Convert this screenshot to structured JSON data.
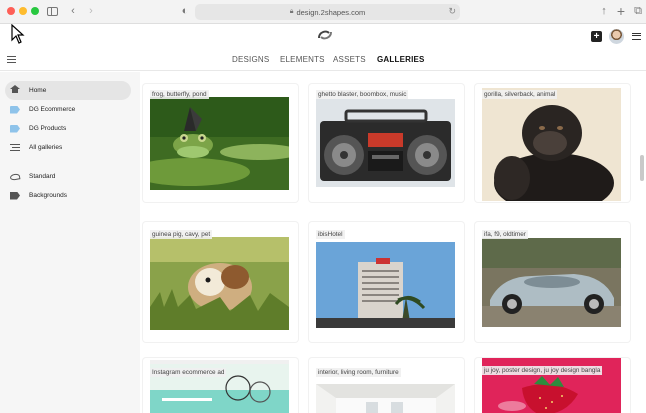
{
  "browser": {
    "url": "design.2shapes.com",
    "icons": [
      "sidebar-toggle-icon",
      "back-icon",
      "forward-icon",
      "privacy-shield-icon",
      "lock-icon",
      "reload-icon",
      "share-icon",
      "new-tab-icon",
      "tab-overview-icon"
    ]
  },
  "header": {
    "add_label": "+",
    "logo_icon": "2shapes-logo-icon"
  },
  "nav": {
    "tabs": [
      {
        "label": "DESIGNS",
        "active": false
      },
      {
        "label": "ELEMENTS",
        "active": false
      },
      {
        "label": "ASSETS",
        "active": false
      },
      {
        "label": "GALLERIES",
        "active": true
      }
    ]
  },
  "sidebar": {
    "items": [
      {
        "label": "Home",
        "icon": "home-icon",
        "active": true
      },
      {
        "label": "DG Ecommerce",
        "icon": "tag-icon",
        "active": false
      },
      {
        "label": "DG Products",
        "icon": "tag-icon",
        "active": false
      },
      {
        "label": "All galleries",
        "icon": "list-icon",
        "active": false
      },
      {
        "label": "Standard",
        "icon": "logo-icon",
        "active": false
      },
      {
        "label": "Backgrounds",
        "icon": "tag-icon",
        "active": false
      }
    ]
  },
  "gallery": {
    "items": [
      {
        "caption": "frog, butterfly, pond"
      },
      {
        "caption": "ghetto blaster, boombox, music"
      },
      {
        "caption": "gorilla, silverback, animal"
      },
      {
        "caption": "guinea pig, cavy, pet"
      },
      {
        "caption": "ibisHotel"
      },
      {
        "caption": "ifa, f9, oldtimer"
      },
      {
        "caption": "Instagram ecommerce ad"
      },
      {
        "caption": "interior, living room, furniture"
      },
      {
        "caption": "ju joy, poster design, ju joy design bangla"
      }
    ]
  },
  "colors": {
    "accent_tag": "#8ec3ea",
    "sidebar_bg": "#f6f6f6",
    "active_item_bg": "#e5e5e5"
  }
}
